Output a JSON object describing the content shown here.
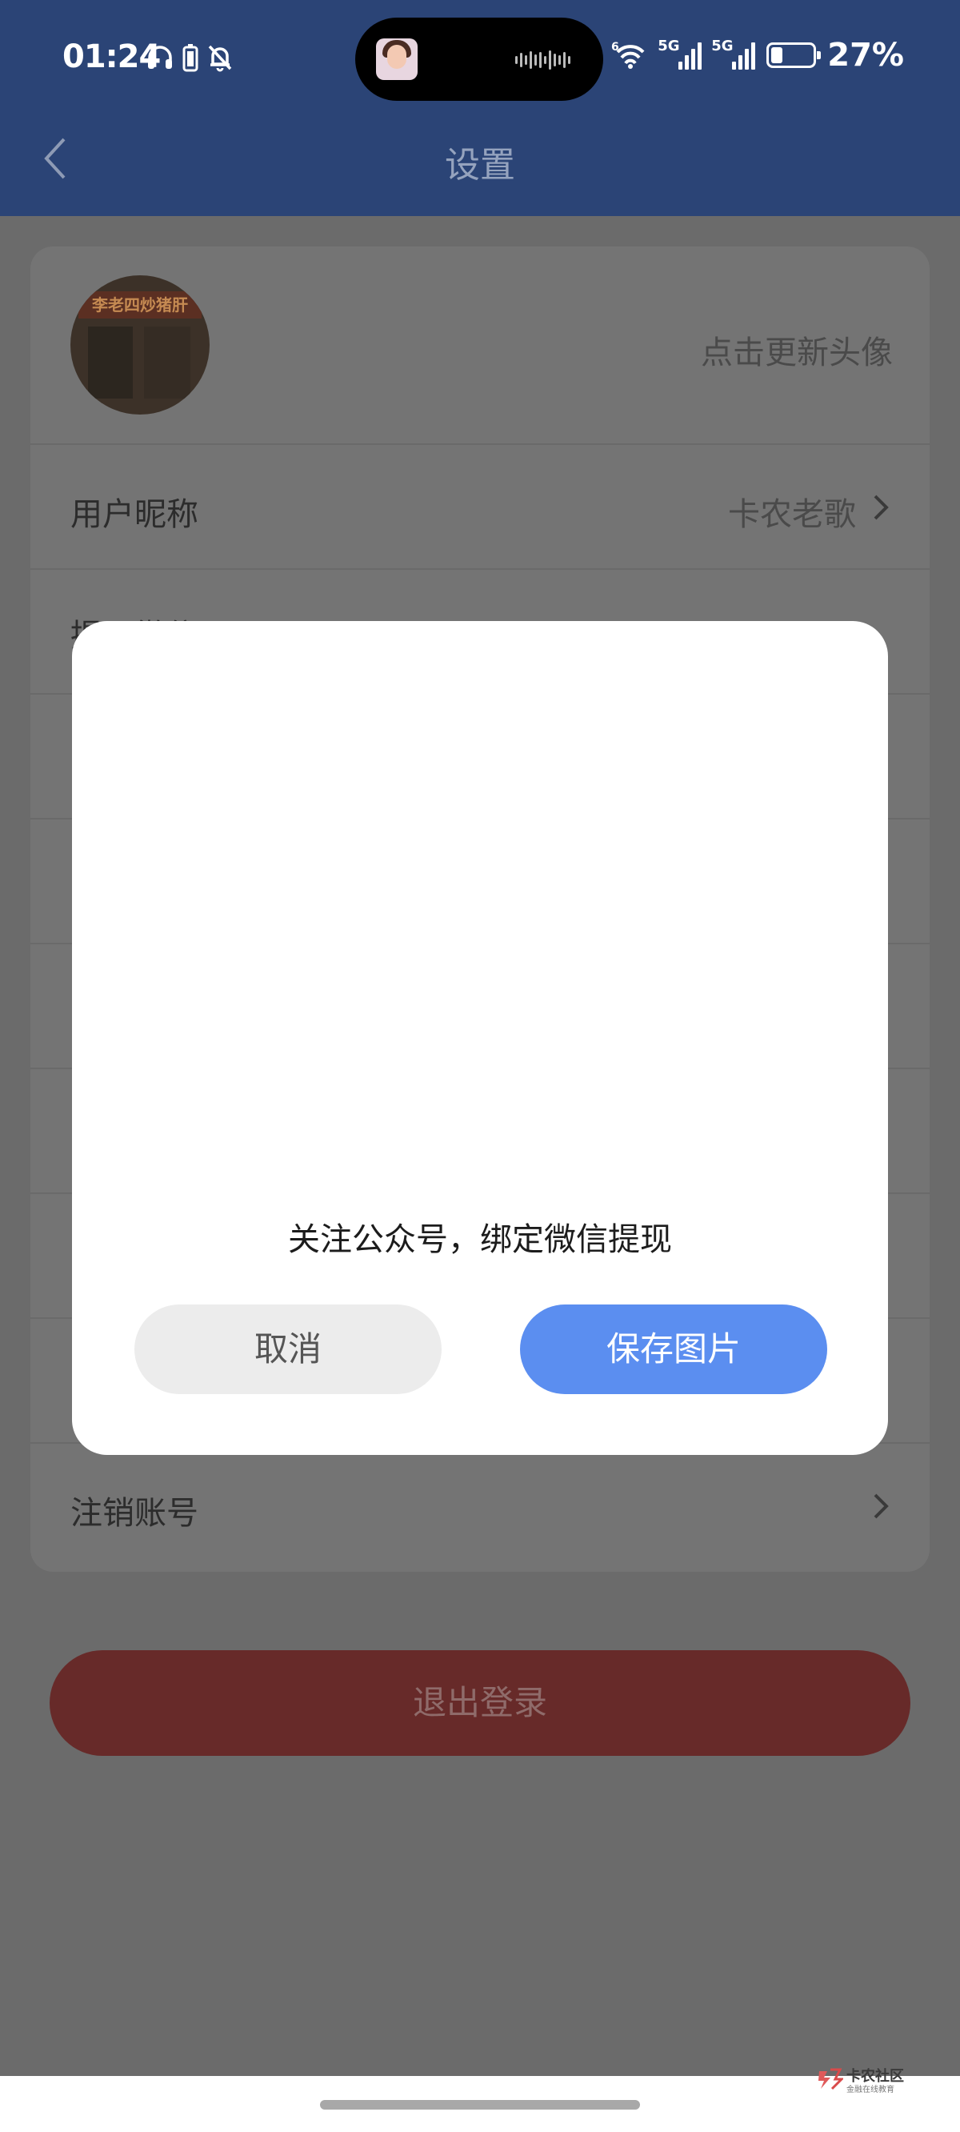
{
  "status_bar": {
    "time": "01:24",
    "network_5g_1": "5G",
    "network_5g_2": "5G",
    "wifi_badge": "6",
    "battery_level": 0.27,
    "battery_text": "27%"
  },
  "header": {
    "title": "设置",
    "icons": [
      "headphones-icon",
      "battery-saver-icon",
      "bell-mute-icon",
      "back-icon"
    ]
  },
  "settings": {
    "avatar_action": "点击更新头像",
    "avatar_sign_text": "李老四炒猪肝",
    "nickname_label": "用户昵称",
    "nickname_value": "卡农老歌",
    "withdraw_label_partial": "提现微信",
    "delete_account_label": "注销账号"
  },
  "logout_button": "退出登录",
  "dialog": {
    "message": "关注公众号，绑定微信提现",
    "cancel": "取消",
    "save": "保存图片"
  },
  "watermark": {
    "title": "卡农社区",
    "subtitle": "金融在线教育"
  },
  "colors": {
    "header_bg": "#2b4476",
    "primary_button": "#5b8ef0",
    "logout_button": "#672a29"
  }
}
